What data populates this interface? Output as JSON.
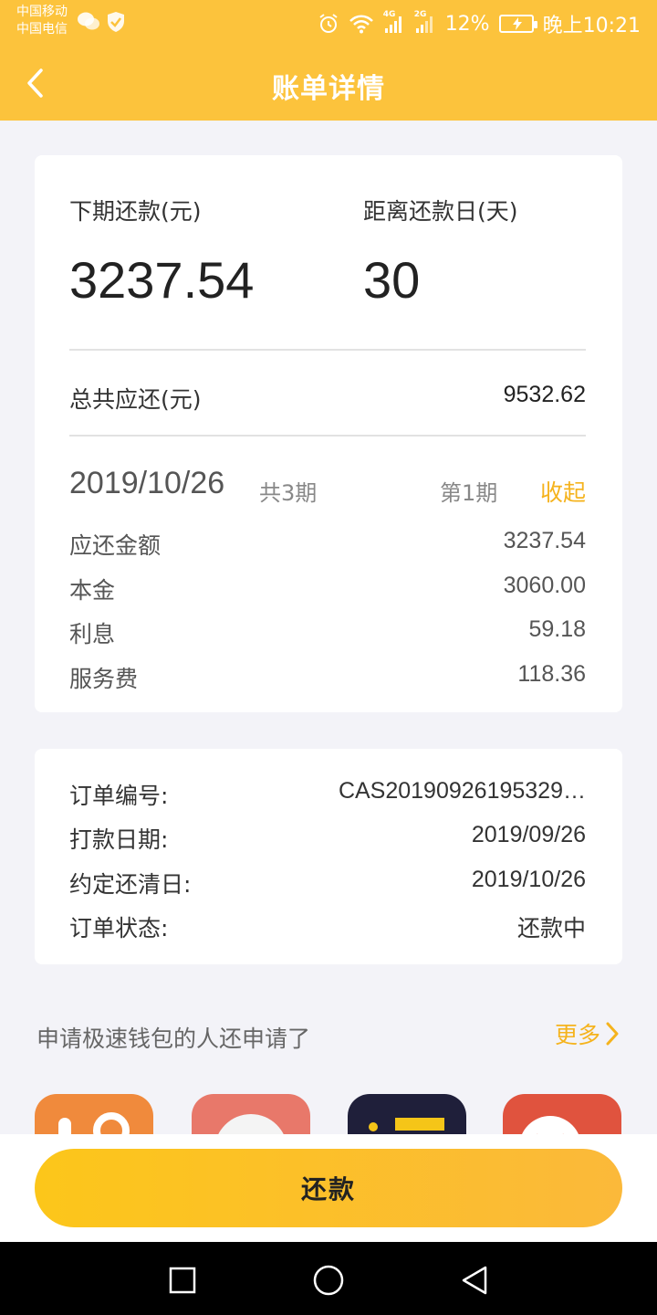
{
  "status_bar": {
    "carrier1": "中国移动",
    "carrier2": "中国电信",
    "battery_percent": "12%",
    "time": "晚上10:21",
    "network_1": "4G",
    "network_2": "2G"
  },
  "nav": {
    "title": "账单详情"
  },
  "summary": {
    "next_label": "下期还款(元)",
    "next_value": "3237.54",
    "days_label": "距离还款日(天)",
    "days_value": "30",
    "total_label": "总共应还(元)",
    "total_value": "9532.62"
  },
  "period": {
    "date": "2019/10/26",
    "count": "共3期",
    "current": "第1期",
    "collapse": "收起",
    "rows": [
      {
        "label": "应还金额",
        "value": "3237.54"
      },
      {
        "label": "本金",
        "value": "3060.00"
      },
      {
        "label": "利息",
        "value": "59.18"
      },
      {
        "label": "服务费",
        "value": "118.36"
      }
    ]
  },
  "order": {
    "rows": [
      {
        "label": "订单编号:",
        "value": "CAS20190926195329…"
      },
      {
        "label": "打款日期:",
        "value": "2019/09/26"
      },
      {
        "label": "约定还清日:",
        "value": "2019/10/26"
      },
      {
        "label": "订单状态:",
        "value": "还款中"
      }
    ]
  },
  "recommend": {
    "title": "申请极速钱包的人还申请了",
    "more": "更多"
  },
  "bottom": {
    "repay": "还款"
  },
  "colors": {
    "accent": "#fcc33c",
    "highlight": "#f5b31d",
    "app1": "#f08a3c",
    "app2": "#e8786a",
    "app3": "#1f1f3a",
    "app4": "#e0533e"
  }
}
